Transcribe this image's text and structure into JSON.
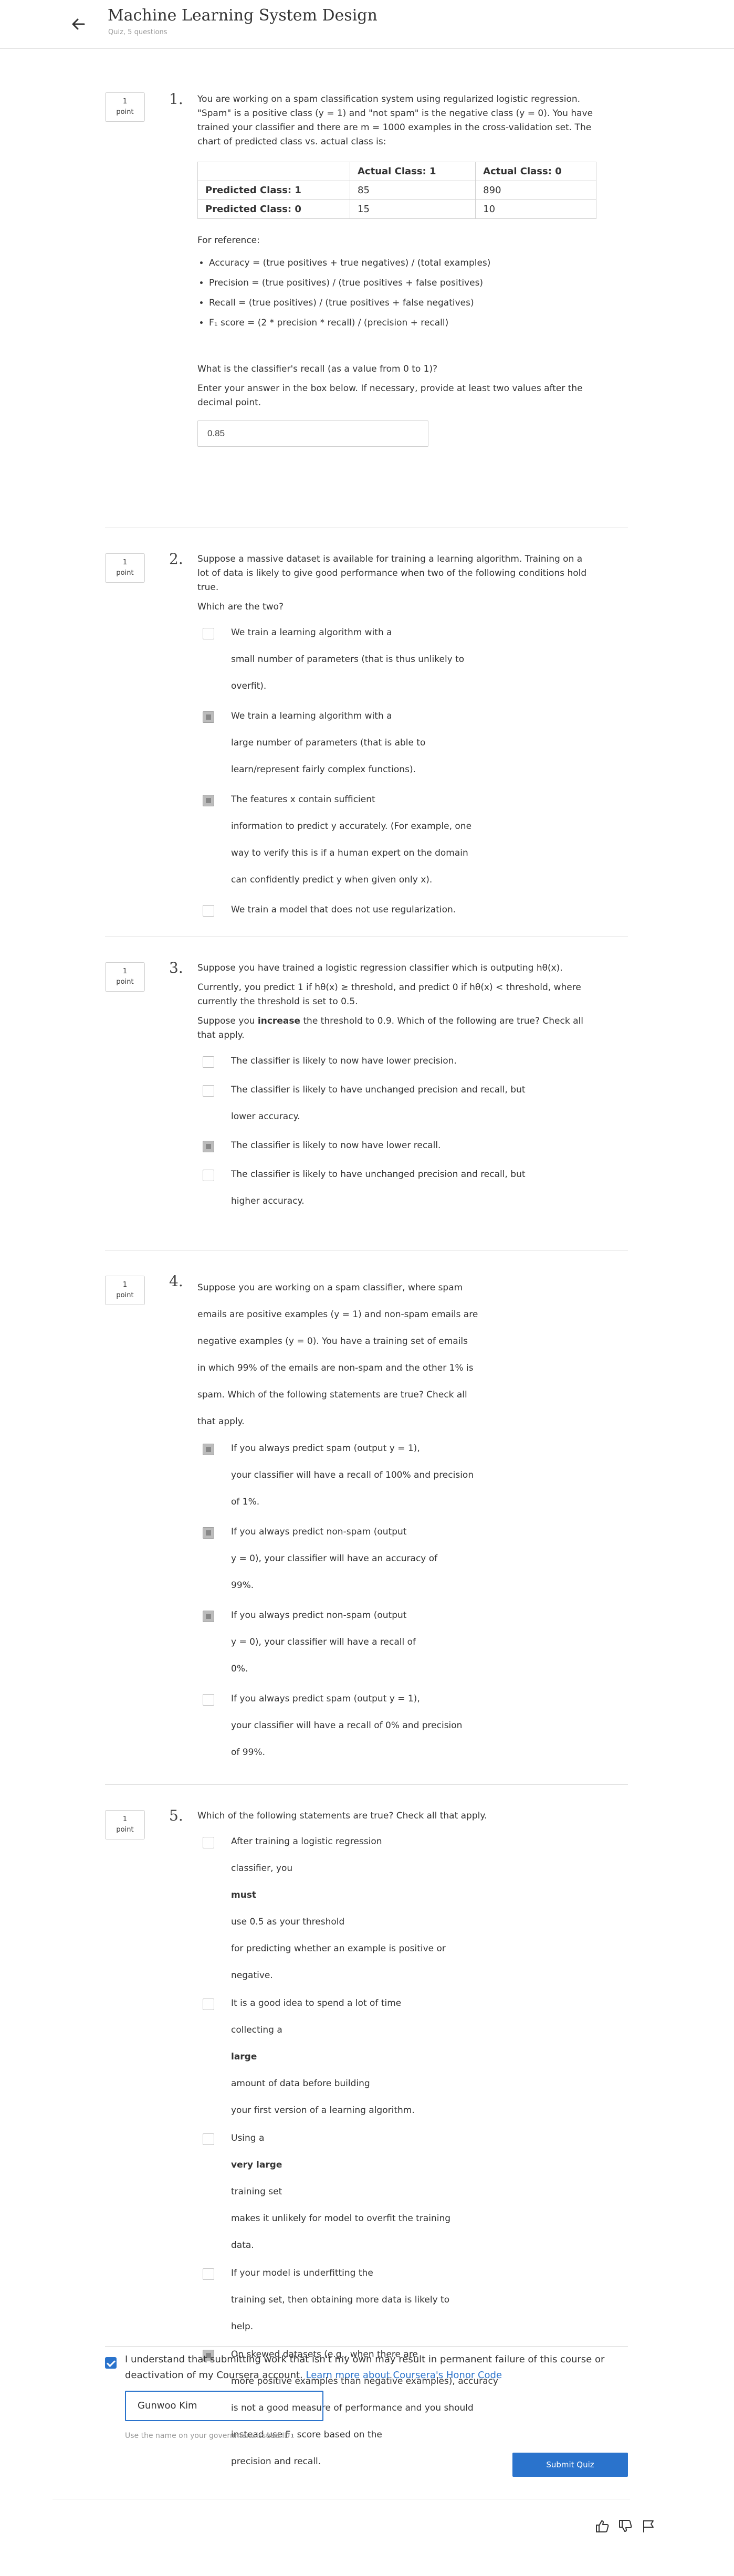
{
  "header": {
    "back_icon": "arrow-left-icon",
    "title": "Machine Learning System Design",
    "subtitle": "Quiz, 5 questions"
  },
  "questions": [
    {
      "number": "1.",
      "points": [
        "1",
        "point"
      ],
      "intro": "You are working on a spam classification system using regularized logistic regression. \"Spam\" is a positive class (y = 1) and \"not spam\" is the negative class (y = 0). You have trained your classifier and there are m = 1000 examples in the cross-validation set. The chart of predicted class vs. actual class is:",
      "table": {
        "headers": [
          "",
          "Actual Class: 1",
          "Actual Class: 0"
        ],
        "rows": [
          [
            "Predicted Class: 1",
            "85",
            "890"
          ],
          [
            "Predicted Class: 0",
            "15",
            "10"
          ]
        ]
      },
      "reference_label": "For reference:",
      "reference": [
        "Accuracy = (true positives + true negatives) / (total examples)",
        "Precision = (true positives) / (true positives + false positives)",
        "Recall = (true positives) / (true positives + false negatives)",
        "F₁ score = (2 * precision * recall) / (precision + recall)"
      ],
      "question": "What is the classifier's recall (as a value from 0 to 1)?",
      "instruction": "Enter your answer in the box below. If necessary, provide at least two values after the decimal point.",
      "answer": "0.85"
    },
    {
      "number": "2.",
      "points": [
        "1",
        "point"
      ],
      "intro": "Suppose a massive dataset is available for training a learning algorithm. Training on a lot of data is likely to give good performance when two of the following conditions hold true.",
      "prompt": "Which are the two?",
      "options": [
        {
          "lines": [
            "We train a learning algorithm with a",
            "small number of parameters (that is thus unlikely to",
            "overfit)."
          ],
          "checked": false
        },
        {
          "lines": [
            "We train a learning algorithm with a",
            "large number of parameters (that is able to",
            "learn/represent fairly complex functions)."
          ],
          "checked": true
        },
        {
          "lines": [
            "The features x contain sufficient",
            "information to predict y accurately. (For example, one",
            "way to verify this is if a human expert on the domain",
            "can confidently predict y when given only x)."
          ],
          "checked": true
        },
        {
          "lines": [
            "We train a model that does not use regularization."
          ],
          "checked": false
        }
      ]
    },
    {
      "number": "3.",
      "points": [
        "1",
        "point"
      ],
      "intro": "Suppose you have trained a logistic regression classifier which is outputing hθ(x).",
      "para2": "Currently, you predict 1 if hθ(x) ≥ threshold, and predict 0 if hθ(x) < threshold, where currently the threshold is set to 0.5.",
      "para3_pre": "Suppose you ",
      "para3_bold": "increase",
      "para3_post": " the threshold to 0.9. Which of the following are true? Check all that apply.",
      "options": [
        {
          "lines": [
            "The classifier is likely to now have lower precision."
          ],
          "checked": false
        },
        {
          "lines": [
            "The classifier is likely to have unchanged precision and recall, but",
            "lower accuracy."
          ],
          "checked": false
        },
        {
          "lines": [
            "The classifier is likely to now have lower recall."
          ],
          "checked": true
        },
        {
          "lines": [
            "The classifier is likely to have unchanged precision and recall, but",
            "higher accuracy."
          ],
          "checked": false
        }
      ]
    },
    {
      "number": "4.",
      "points": [
        "1",
        "point"
      ],
      "intro_lines": [
        "Suppose you are working on a spam classifier, where spam",
        "emails are positive examples (y = 1) and non-spam emails are",
        "negative examples (y = 0). You have a training set of emails",
        "in which 99% of the emails are non-spam and the other 1% is",
        "spam. Which of the following statements are true? Check all",
        "that apply."
      ],
      "options": [
        {
          "lines": [
            "If you always predict spam (output y = 1),",
            "your classifier will have a recall of 100% and precision",
            "of 1%."
          ],
          "checked": true
        },
        {
          "lines": [
            "If you always predict non-spam (output",
            "y = 0), your classifier will have an accuracy of",
            "99%."
          ],
          "checked": true
        },
        {
          "lines": [
            "If you always predict non-spam (output",
            "y = 0), your classifier will have a recall of",
            "0%."
          ],
          "checked": true
        },
        {
          "lines": [
            "If you always predict spam (output y = 1),",
            "your classifier will have a recall of 0% and precision",
            "of 99%."
          ],
          "checked": false
        }
      ]
    },
    {
      "number": "5.",
      "points": [
        "1",
        "point"
      ],
      "intro": "Which of the following statements are true? Check all that apply.",
      "options": [
        {
          "lines": [
            "After training a logistic regression",
            "classifier, you |must| use 0.5 as your threshold",
            "for predicting whether an example is positive or",
            "negative."
          ],
          "checked": false
        },
        {
          "lines": [
            "It is a good idea to spend a lot of time",
            "collecting a |large| amount of data before building",
            "your first version of a learning algorithm."
          ],
          "checked": false
        },
        {
          "lines": [
            "Using a |very large| training set",
            "makes it unlikely for model to overfit the training",
            "data."
          ],
          "checked": false
        },
        {
          "lines": [
            "If your model is underfitting the",
            "training set, then obtaining more data is likely to",
            "help."
          ],
          "checked": false
        },
        {
          "lines": [
            "On skewed datasets (e.g., when there are",
            "more positive examples than negative examples), accuracy",
            "is not a good measure of performance and you should",
            "instead use F₁ score based on the",
            "precision and recall."
          ],
          "checked": true
        }
      ]
    }
  ],
  "honor": {
    "checked": true,
    "text": "I understand that submitting work that isn't my own may result in permanent failure of this course or deactivation of my Coursera account.",
    "link": "Learn more about Coursera's Honor Code",
    "name_value": "Gunwoo Kim",
    "name_hint": "Use the name on your government issued ID",
    "submit_label": "Submit Quiz"
  },
  "footer": {
    "icons": [
      "thumbs-up-icon",
      "thumbs-down-icon",
      "flag-icon"
    ]
  },
  "colors": {
    "accent": "#2a73cc",
    "checked_box": "#bcbcbc",
    "divider": "#dcdcdc"
  }
}
